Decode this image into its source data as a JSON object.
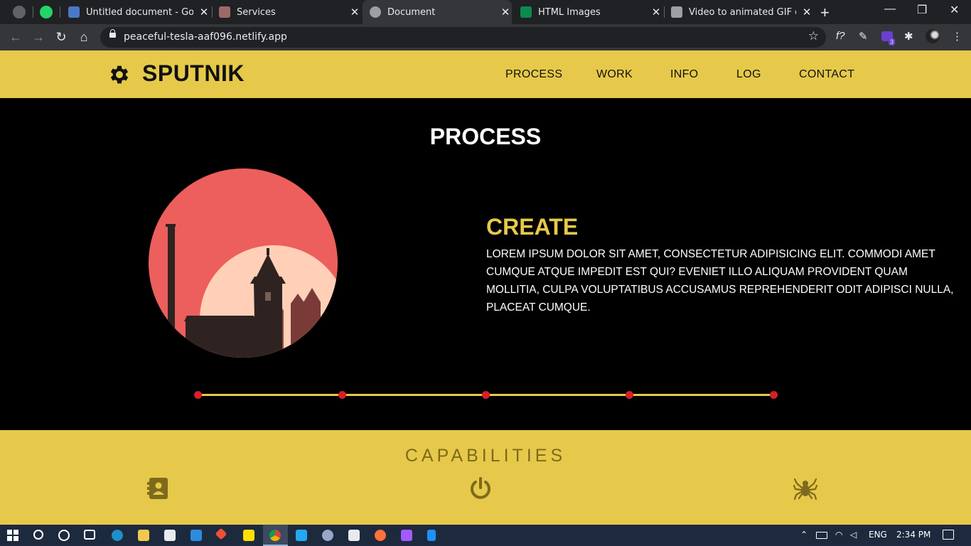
{
  "browser": {
    "tabs": [
      {
        "title": "Untitled document - Google Docs",
        "favicon_color": "#4a78c8",
        "active": false
      },
      {
        "title": "Services",
        "favicon_color": "#9c6a66",
        "active": false
      },
      {
        "title": "Document",
        "favicon_color": "#9aa0a6",
        "active": true
      },
      {
        "title": "HTML Images",
        "favicon_color": "#0d8a4f",
        "active": false
      },
      {
        "title": "Video to animated GIF converter",
        "favicon_color": "#9aa0a6",
        "active": false
      }
    ],
    "url": "peaceful-tesla-aaf096.netlify.app",
    "close_glyph": "✕",
    "new_tab_glyph": "+",
    "window_controls": [
      "—",
      "❐",
      "✕"
    ],
    "nav_glyphs": {
      "back": "←",
      "forward": "→",
      "reload": "↻",
      "home": "⌂",
      "star": "☆"
    },
    "extension_glyphs": [
      "f?",
      "✎",
      "✱",
      "⋮"
    ],
    "extension_badge": "3"
  },
  "site": {
    "brand": "SPUTNIK",
    "logo_icon": "gear-icon",
    "nav": [
      "PROCESS",
      "WORK",
      "INFO",
      "LOG",
      "CONTACT"
    ],
    "colors": {
      "accent": "#e6c94a",
      "dot": "#d91f26",
      "background": "#000000"
    }
  },
  "process": {
    "title": "PROCESS",
    "step_title": "CREATE",
    "step_body": "LOREM IPSUM DOLOR SIT AMET, CONSECTETUR ADIPISICING ELIT. COMMODI AMET CUMQUE ATQUE IMPEDIT EST QUI? EVENIET ILLO ALIQUAM PROVIDENT QUAM MOLLITIA, CULPA VOLUPTATIBUS ACCUSAMUS REPREHENDERIT ODIT ADIPISCI NULLA, PLACEAT CUMQUE.",
    "steps_count": 5
  },
  "capabilities": {
    "title": "CAPABILITIES",
    "icons": [
      "contact-book-icon",
      "power-icon",
      "spider-icon"
    ]
  },
  "taskbar": {
    "language": "ENG",
    "time": "2:34 PM"
  }
}
